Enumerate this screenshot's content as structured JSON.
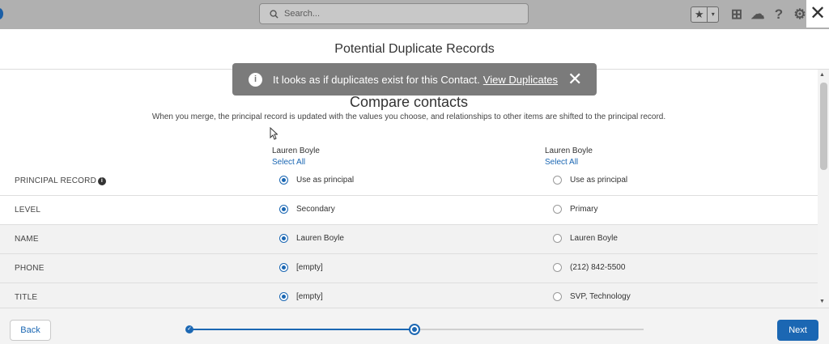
{
  "header": {
    "search_placeholder": "Search...",
    "icons": [
      "search-icon",
      "star-icon",
      "chevron-down-icon",
      "add-icon",
      "setup-assistant-icon",
      "help-icon",
      "gear-icon",
      "close-icon"
    ],
    "favorite_star": "★",
    "favorite_caret": "▾",
    "add_glyph": "⊞",
    "trailhead_glyph": "☁",
    "help_glyph": "?",
    "gear_glyph": "⚙",
    "close_glyph": "✕"
  },
  "modal": {
    "title": "Potential Duplicate Records"
  },
  "toast": {
    "info_glyph": "i",
    "message": "It looks as if duplicates exist for this Contact.",
    "link": "View Duplicates",
    "close_glyph": "✕"
  },
  "compare": {
    "title": "Compare contacts",
    "description": "When you merge, the principal record is updated with the values you choose, and relationships to other items are shifted to the principal record.",
    "columns": [
      {
        "name": "Lauren Boyle",
        "select_all": "Select All"
      },
      {
        "name": "Lauren Boyle",
        "select_all": "Select All"
      }
    ],
    "rows": [
      {
        "label": "PRINCIPAL RECORD",
        "left": "Use as principal",
        "right": "Use as principal",
        "selected": "left"
      },
      {
        "label": "LEVEL",
        "left": "Secondary",
        "right": "Primary",
        "selected": "left"
      },
      {
        "label": "NAME",
        "left": "Lauren Boyle",
        "right": "Lauren Boyle",
        "selected": "left"
      },
      {
        "label": "PHONE",
        "left": "[empty]",
        "right": "(212) 842-5500",
        "selected": "left"
      },
      {
        "label": "TITLE",
        "left": "[empty]",
        "right": "SVP, Technology",
        "selected": "left"
      }
    ],
    "principal_info_glyph": "i"
  },
  "footer": {
    "back_label": "Back",
    "next_label": "Next",
    "progress": {
      "total_steps": 3,
      "current_step": 2
    },
    "step_done_glyph": "✓"
  },
  "colors": {
    "accent": "#1b67b3",
    "header_bg": "#b0b0b0",
    "toast_bg": "#7b7b7b"
  }
}
